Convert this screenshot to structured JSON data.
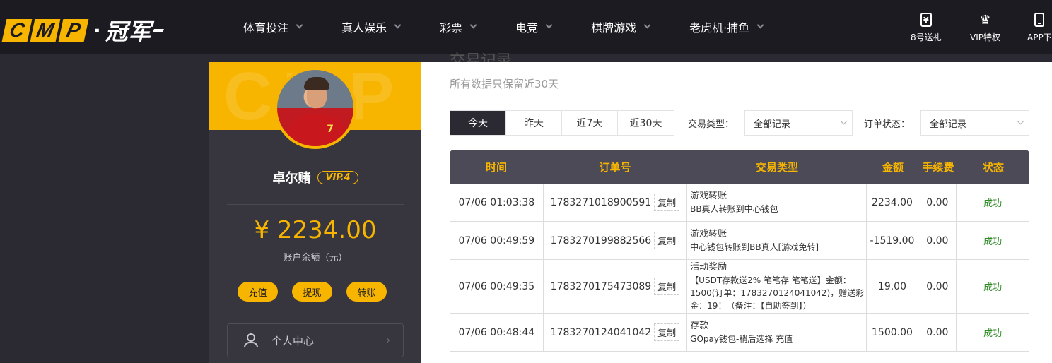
{
  "logo": {
    "letters": [
      "C",
      "M",
      "P"
    ],
    "dot": "·",
    "cn": "冠军"
  },
  "nav": [
    {
      "label": "体育投注"
    },
    {
      "label": "真人娱乐"
    },
    {
      "label": "彩票"
    },
    {
      "label": "电竞"
    },
    {
      "label": "棋牌游戏"
    },
    {
      "label": "老虎机·捕鱼"
    }
  ],
  "quick_links": [
    {
      "label": "8号送礼",
      "icon": "ticket-icon",
      "glyph": "¥"
    },
    {
      "label": "VIP特权",
      "icon": "crown-icon",
      "glyph": "♛"
    },
    {
      "label": "APP下",
      "icon": "phone-icon"
    }
  ],
  "profile": {
    "watermark": "CMP",
    "username": "卓尔赌",
    "vip": "VIP.4",
    "balance": "¥ 2234.00",
    "balance_label": "账户余额（元）",
    "actions": [
      "充值",
      "提现",
      "转账"
    ],
    "menu_label": "个人中心"
  },
  "main": {
    "title": "交易记录",
    "subtitle": "所有数据只保留近30天",
    "date_tabs": [
      "今天",
      "昨天",
      "近7天",
      "近30天"
    ],
    "active_tab": "今天",
    "filters": {
      "type_label": "交易类型：",
      "type_value": "全部记录",
      "status_label": "订单状态：",
      "status_value": "全部记录"
    },
    "copy_label": "复制"
  },
  "table": {
    "headers": [
      "时间",
      "订单号",
      "交易类型",
      "金额",
      "手续费",
      "状态"
    ],
    "rows": [
      {
        "time": "07/06 01:03:38",
        "order": "1783271018900591",
        "type_title": "游戏转账",
        "type_desc": "BB真人转账到中心钱包",
        "amount": "2234.00",
        "fee": "0.00",
        "status": "成功"
      },
      {
        "time": "07/06 00:49:59",
        "order": "1783270199882566",
        "type_title": "游戏转账",
        "type_desc": "中心钱包转账到BB真人[游戏免转]",
        "amount": "-1519.00",
        "fee": "0.00",
        "status": "成功"
      },
      {
        "time": "07/06 00:49:35",
        "order": "1783270175473089",
        "type_title": "活动奖励",
        "type_desc": "【USDT存款送2% 笔笔存 笔笔送】金额：1500(订单：1783270124041042)，赠送彩金：19！（备注：【自助签到】）",
        "amount": "19.00",
        "fee": "0.00",
        "status": "成功"
      },
      {
        "time": "07/06 00:48:44",
        "order": "1783270124041042",
        "type_title": "存款",
        "type_desc": "GOpay钱包-稍后选择 充值",
        "amount": "1500.00",
        "fee": "0.00",
        "status": "成功"
      }
    ]
  },
  "colors": {
    "accent": "#f7b500",
    "header_bg": "#1c1b21",
    "sidebar_bg": "#37363f",
    "success": "#2e8b24"
  }
}
